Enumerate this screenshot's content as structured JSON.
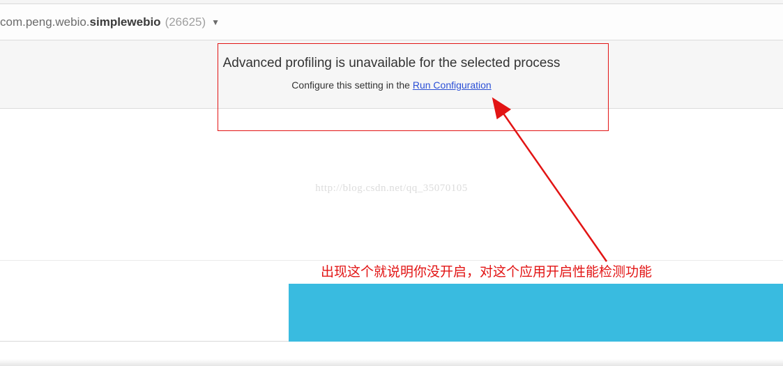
{
  "process": {
    "package_prefix": "com.peng.webio.",
    "package_bold": "simplewebio",
    "pid": "(26625)"
  },
  "notice": {
    "heading": "Advanced profiling is unavailable for the selected process",
    "sub_prefix": "Configure this setting in the ",
    "link_label": "Run Configuration"
  },
  "watermark": "http://blog.csdn.net/qq_35070105",
  "annotation": {
    "text": "出现这个就说明你没开启，对这个应用开启性能检测功能"
  }
}
